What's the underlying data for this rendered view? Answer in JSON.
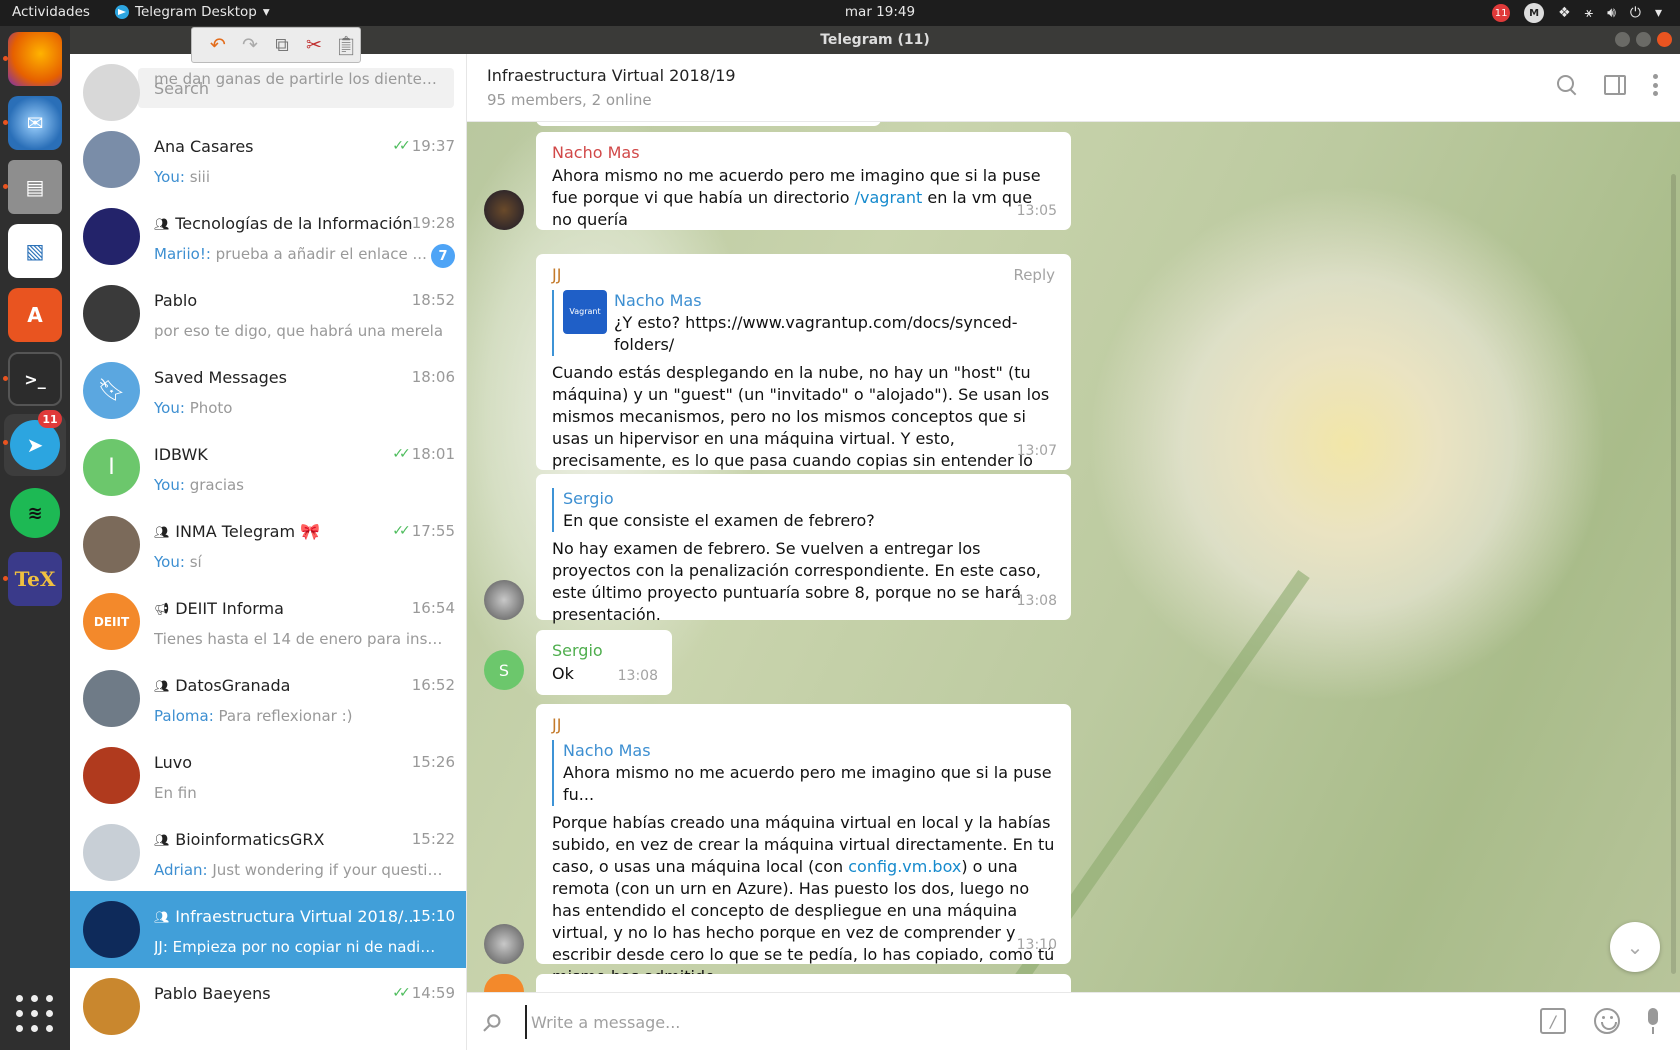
{
  "topbar": {
    "activities": "Actividades",
    "app_name": "Telegram Desktop",
    "clock": "mar 19:49",
    "tray_badge": "11"
  },
  "dock": {
    "items": [
      {
        "name": "Firefox",
        "icon": "firefox-icon",
        "color": "#e66000"
      },
      {
        "name": "Thunderbird",
        "icon": "mail-icon",
        "color": "#2a6fb8"
      },
      {
        "name": "Files",
        "icon": "files-icon",
        "color": "#8e8e8e"
      },
      {
        "name": "LibreOffice Draw",
        "icon": "document-icon",
        "color": "#2c72b8"
      },
      {
        "name": "Ubuntu Software",
        "icon": "software-center-icon",
        "color": "#e95420"
      },
      {
        "name": "Terminal",
        "icon": "terminal-icon",
        "color": "#2c2c2c"
      },
      {
        "name": "Telegram",
        "icon": "telegram-icon",
        "color": "#2ca5e0",
        "badge": "11"
      },
      {
        "name": "Spotify",
        "icon": "spotify-icon",
        "color": "#1db954"
      },
      {
        "name": "TeX",
        "icon": "tex-icon",
        "color": "#3a3a8a"
      }
    ]
  },
  "window": {
    "title": "Telegram (11)"
  },
  "search": {
    "placeholder": "Search"
  },
  "chats": [
    {
      "name": "",
      "time": "",
      "preview_prefix": "",
      "preview": "me dan ganas de partirle los dientes a jj",
      "avatar_color": "#d8d8d8",
      "avatar_letter": "",
      "group": false
    },
    {
      "name": "Ana Casares",
      "time": "19:37",
      "read": true,
      "preview_prefix": "You: ",
      "preview": "siii",
      "avatar_color": "#7a8da8",
      "avatar_letter": "",
      "group": false
    },
    {
      "name": "Tecnologías de la Información",
      "time": "19:28",
      "preview_prefix": "Mariio!: ",
      "preview": "prueba a añadir el enlace ...",
      "unread": "7",
      "avatar_color": "#23236a",
      "avatar_letter": "",
      "group": true
    },
    {
      "name": "Pablo",
      "time": "18:52",
      "preview_prefix": "",
      "preview": "por eso te digo, que habrá una merela",
      "avatar_color": "#3a3a3a",
      "avatar_letter": "",
      "group": false
    },
    {
      "name": "Saved Messages",
      "time": "18:06",
      "preview_prefix": "You: ",
      "preview": "Photo",
      "avatar_color": "#5ba7e0",
      "avatar_letter": "",
      "group": false,
      "saved": true
    },
    {
      "name": "IDBWK",
      "time": "18:01",
      "read": true,
      "preview_prefix": "You: ",
      "preview": "gracias",
      "avatar_color": "#6cc76c",
      "avatar_letter": "I",
      "group": false
    },
    {
      "name": "INMA Telegram 🎀",
      "time": "17:55",
      "read": true,
      "preview_prefix": "You: ",
      "preview": "sí",
      "avatar_color": "#7b6a5a",
      "avatar_letter": "",
      "group": true
    },
    {
      "name": "DEIIT Informa",
      "time": "16:54",
      "preview_prefix": "",
      "preview": "Tienes hasta el 14 de enero para inscri...",
      "avatar_color": "#f3892b",
      "avatar_letter": "DEIIT",
      "group": false,
      "channel": true
    },
    {
      "name": "DatosGranada",
      "time": "16:52",
      "preview_prefix": "Paloma: ",
      "preview": "Para reflexionar :)",
      "avatar_color": "#6f7b87",
      "avatar_letter": "",
      "group": true
    },
    {
      "name": "Luvo",
      "time": "15:26",
      "preview_prefix": "",
      "preview": "En fin",
      "avatar_color": "#b03a1e",
      "avatar_letter": "",
      "group": false
    },
    {
      "name": "BioinformaticsGRX",
      "time": "15:22",
      "preview_prefix": "Adrian: ",
      "preview": "Just wondering if your questio...",
      "avatar_color": "#c8cfd6",
      "avatar_letter": "",
      "group": true
    },
    {
      "name": "Infraestructura Virtual 2018/...",
      "time": "15:10",
      "preview_prefix": "JJ: ",
      "preview": "Empieza por no copiar ni de nadie n...",
      "avatar_color": "#0e2a5a",
      "avatar_letter": "",
      "group": true,
      "active": true
    },
    {
      "name": "Pablo Baeyens",
      "time": "14:59",
      "read": true,
      "preview_prefix": "",
      "preview": "",
      "avatar_color": "#c9872e",
      "avatar_letter": "",
      "group": false
    }
  ],
  "chat": {
    "title": "Infraestructura Virtual 2018/19",
    "subtitle": "95 members, 2 online",
    "messages": [
      {
        "sender": "Nacho Mas",
        "sender_color": "#d14848",
        "text_before": "Ahora mismo no me acuerdo pero me imagino que si la puse fue porque vi que había un directorio ",
        "link": "/vagrant",
        "text_after": " en la vm que no quería",
        "time": "13:05"
      },
      {
        "sender": "JJ",
        "sender_color": "#c47a2a",
        "reply_label": "Reply",
        "quote_name": "Nacho Mas",
        "quote_text": "¿Y esto? https://www.vagrantup.com/docs/synced-folders/",
        "quote_thumb": "Vagrant",
        "text": "Cuando estás desplegando en la nube, no hay un  \"host\" (tu máquina) y un \"guest\" (un \"invitado\" o \"alojado\"). Se usan los mismos mecanismos, pero no los mismos conceptos que si usas un hipervisor en una máquina virtual. Y esto, precisamente, es lo que pasa cuando copias sin entender lo que estás haciendo.",
        "time": "13:07"
      },
      {
        "quote_name": "Sergio",
        "quote_text": "En que consiste el examen de febrero?",
        "text": "No hay examen de febrero. Se vuelven a entregar los proyectos con la penalización correspondiente. En este caso, este último proyecto puntuaría sobre 8, porque no se hará presentación.",
        "time": "13:08"
      },
      {
        "sender": "Sergio",
        "sender_color": "#4fae4e",
        "text": "Ok",
        "time": "13:08",
        "avatar_letter": "S"
      },
      {
        "sender": "JJ",
        "sender_color": "#c47a2a",
        "quote_name": "Nacho Mas",
        "quote_text": "Ahora mismo no me acuerdo pero me imagino que si la puse fu...",
        "text_before": "Porque habías creado una máquina virtual en local y la habías subido, en vez de crear la máquina virtual directamente. En tu caso, o usas una máquina local (con ",
        "link": "config.vm.box",
        "text_after": ") o una remota (con un urn en Azure). Has puesto los dos, luego no has entendido el concepto de despliegue en una máquina virtual, y no lo has hecho porque en vez de comprender y escribir desde cero lo que se te pedía, lo has copiado, como tú mismo has admitido.",
        "time": "13:10"
      }
    ]
  },
  "composer": {
    "placeholder": "Write a message..."
  }
}
